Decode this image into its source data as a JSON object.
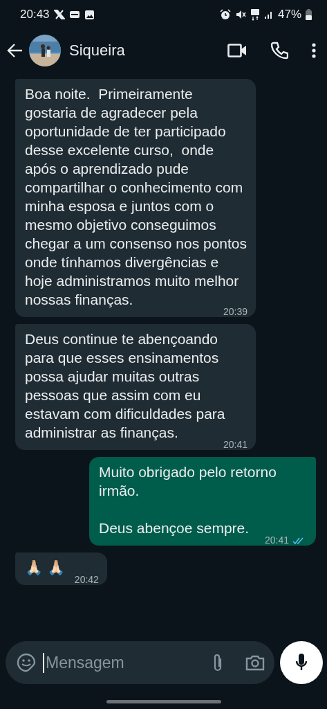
{
  "status_bar": {
    "time": "20:43",
    "battery": "47%"
  },
  "header": {
    "contact_name": "Siqueira"
  },
  "messages": [
    {
      "kind": "incoming",
      "text": "Boa noite.  Primeiramente gostaria de agradecer pela oportunidade de ter participado desse excelente curso,  onde após o aprendizado pude compartilhar o conhecimento com minha esposa e juntos com o mesmo objetivo conseguimos chegar a um consenso nos pontos onde tínhamos divergências e hoje administramos muito melhor nossas finanças.",
      "time": "20:39"
    },
    {
      "kind": "incoming",
      "text": "Deus continue te abençoando para que esses ensinamentos possa ajudar muitas outras pessoas que assim com eu estavam com dificuldades para administrar as finanças.",
      "time": "20:41"
    },
    {
      "kind": "outgoing",
      "text": "Muito obrigado pelo retorno irmão.\n\nDeus abençoe sempre.",
      "time": "20:41",
      "read": true
    },
    {
      "kind": "incoming",
      "text": "🙏🏻 🙏🏻",
      "time": "20:42"
    }
  ],
  "composer": {
    "placeholder": "Mensagem"
  }
}
